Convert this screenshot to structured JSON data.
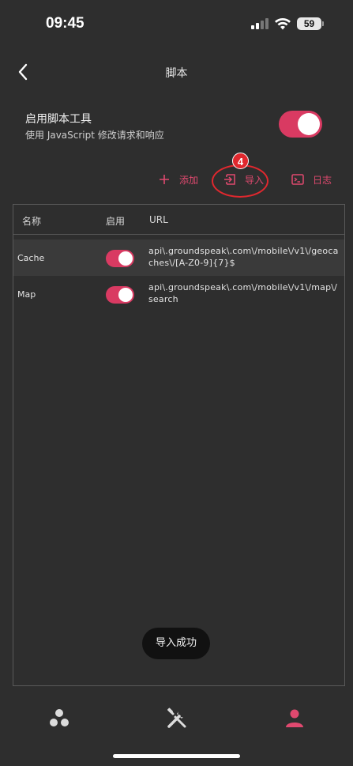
{
  "status_bar": {
    "time": "09:45",
    "battery": "59"
  },
  "header": {
    "title": "脚本",
    "back_icon": "chevron-left-icon"
  },
  "enable": {
    "title": "启用脚本工具",
    "subtitle": "使用 JavaScript 修改请求和响应",
    "toggle_on": true
  },
  "actions": {
    "add_label": "添加",
    "import_label": "导入",
    "log_label": "日志"
  },
  "annotation": {
    "badge": "4"
  },
  "table": {
    "columns": [
      "名称",
      "启用",
      "URL"
    ],
    "rows": [
      {
        "name": "Cache",
        "enabled": true,
        "url": "api\\.groundspeak\\.com\\/mobile\\/v1\\/geocaches\\/[A-Z0-9]{7}$"
      },
      {
        "name": "Map",
        "enabled": true,
        "url": "api\\.groundspeak\\.com\\/mobile\\/v1\\/map\\/search"
      }
    ]
  },
  "toast": "导入成功",
  "colors": {
    "accent": "#e0496f",
    "toggle": "#d93a62",
    "background": "#2e2e2e",
    "annotation": "#e0282e"
  },
  "bottom_nav": [
    "circles-icon",
    "tools-icon",
    "person-icon"
  ]
}
